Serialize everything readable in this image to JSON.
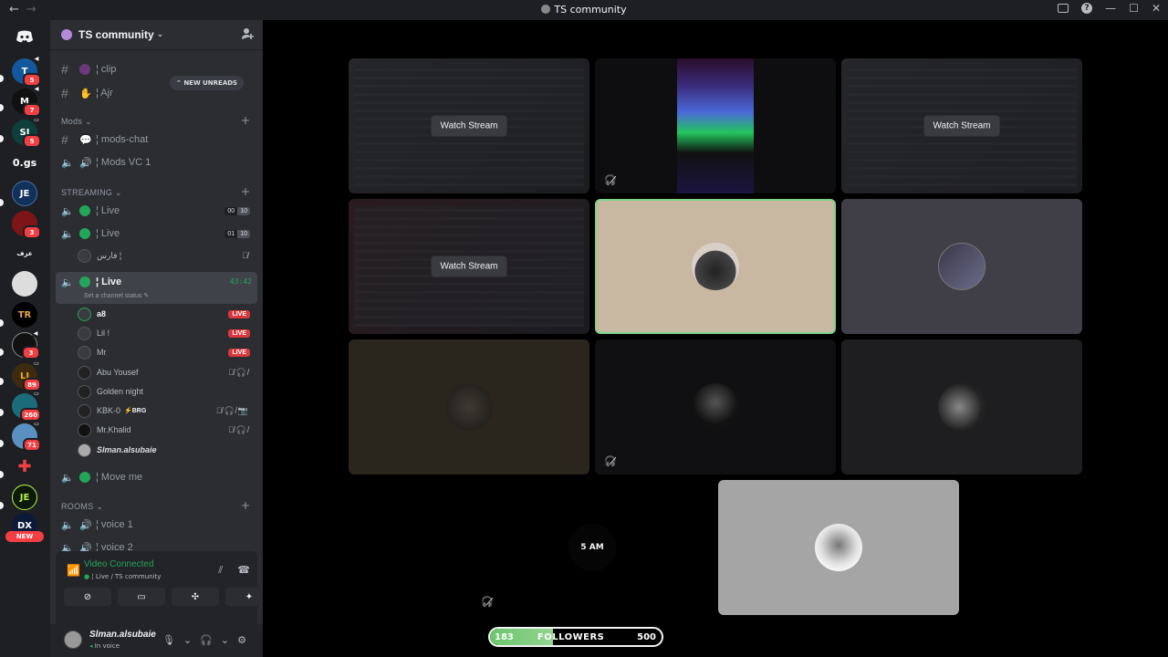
{
  "window": {
    "title": "TS community",
    "back": "←",
    "forward": "→"
  },
  "guild": {
    "name": "TS community",
    "new_unreads": "NEW UNREADS"
  },
  "servers": [
    {
      "label": "T",
      "badge": "5"
    },
    {
      "label": "M",
      "badge": "7"
    },
    {
      "label": "SI",
      "badge": "5"
    },
    {
      "label": "0.gs",
      "badge": ""
    },
    {
      "label": "JE",
      "badge": ""
    },
    {
      "label": "",
      "badge": "3"
    },
    {
      "label": "عزف",
      "badge": ""
    },
    {
      "label": "",
      "badge": ""
    },
    {
      "label": "TR",
      "badge": ""
    },
    {
      "label": "",
      "badge": "3"
    },
    {
      "label": "LJ",
      "badge": "89"
    },
    {
      "label": "",
      "badge": "260"
    },
    {
      "label": "",
      "badge": "71"
    },
    {
      "label": "",
      "badge": ""
    },
    {
      "label": "JE",
      "badge": ""
    },
    {
      "label": "DX",
      "badge": ""
    }
  ],
  "server_new": "NEW",
  "channels": {
    "clip": "¦ clip",
    "ajr": "¦ Ajr",
    "cat_mods": "Mods",
    "mods_chat": "¦ mods-chat",
    "mods_vc": "¦ Mods VC 1",
    "cat_streaming": "STREAMING",
    "live1": "¦ Live",
    "live1_counts": [
      "00",
      "10"
    ],
    "live2": "¦ Live",
    "live2_counts": [
      "01",
      "10"
    ],
    "live2_user": "فارس ¦",
    "live3": "¦ Live",
    "live3_timer": "43:42",
    "live3_status": "Set a channel status",
    "move_me": "¦ Move me",
    "cat_rooms": "ROOMS",
    "voice1": "¦ voice 1",
    "voice2": "¦ voice 2"
  },
  "voice_users": [
    {
      "name": "a8",
      "live": "LIVE",
      "strong": true
    },
    {
      "name": "Lil !",
      "live": "LIVE"
    },
    {
      "name": "Mr",
      "live": "LIVE"
    },
    {
      "name": "Abu Yousef",
      "icons": "🎙̸🎧̸"
    },
    {
      "name": "Golden night"
    },
    {
      "name": "KBK-0",
      "tag": "⚡BRG",
      "icons": "🎙̸🎧̸📷"
    },
    {
      "name": "Mr.Khalid",
      "icons": "🎙̸🎧̸"
    },
    {
      "name": "Slman.alsubaie"
    }
  ],
  "voice_panel": {
    "title": "Video Connected",
    "subtitle": "¦ Live / TS community"
  },
  "user_panel": {
    "name": "Slman.alsubaie",
    "status": "In voice"
  },
  "stream_tiles": [
    {
      "type": "screen",
      "label": "Watch Stream"
    },
    {
      "type": "video"
    },
    {
      "type": "screen",
      "label": "Watch Stream"
    },
    {
      "type": "screen",
      "label": "Watch Stream"
    },
    {
      "type": "avatar",
      "selected": true
    },
    {
      "type": "avatar"
    },
    {
      "type": "avatar"
    },
    {
      "type": "avatar"
    },
    {
      "type": "avatar"
    },
    {
      "type": "avatar"
    }
  ],
  "small_tile_text": "5 AM",
  "followers": {
    "current": "183",
    "label": "FOLLOWERS",
    "goal": "500",
    "progress": 0.366
  },
  "colors": {
    "accent_green": "#23a55a",
    "live_red": "#da373c",
    "badge_red": "#f23f43"
  }
}
